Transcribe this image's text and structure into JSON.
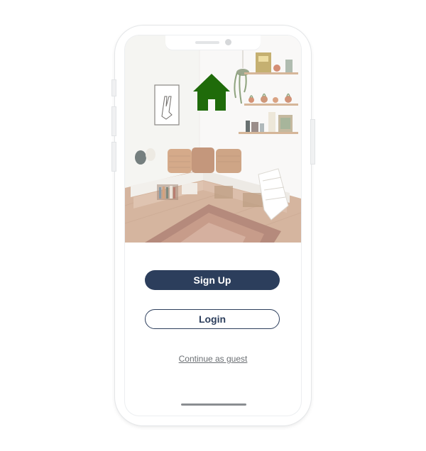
{
  "colors": {
    "primary": "#2c3e5c",
    "logo": "#1f6b0a",
    "link": "#6b6f73"
  },
  "hero": {
    "logo_icon": "home-icon"
  },
  "actions": {
    "sign_up_label": "Sign Up",
    "login_label": "Login",
    "guest_link": "Continue as guest"
  }
}
